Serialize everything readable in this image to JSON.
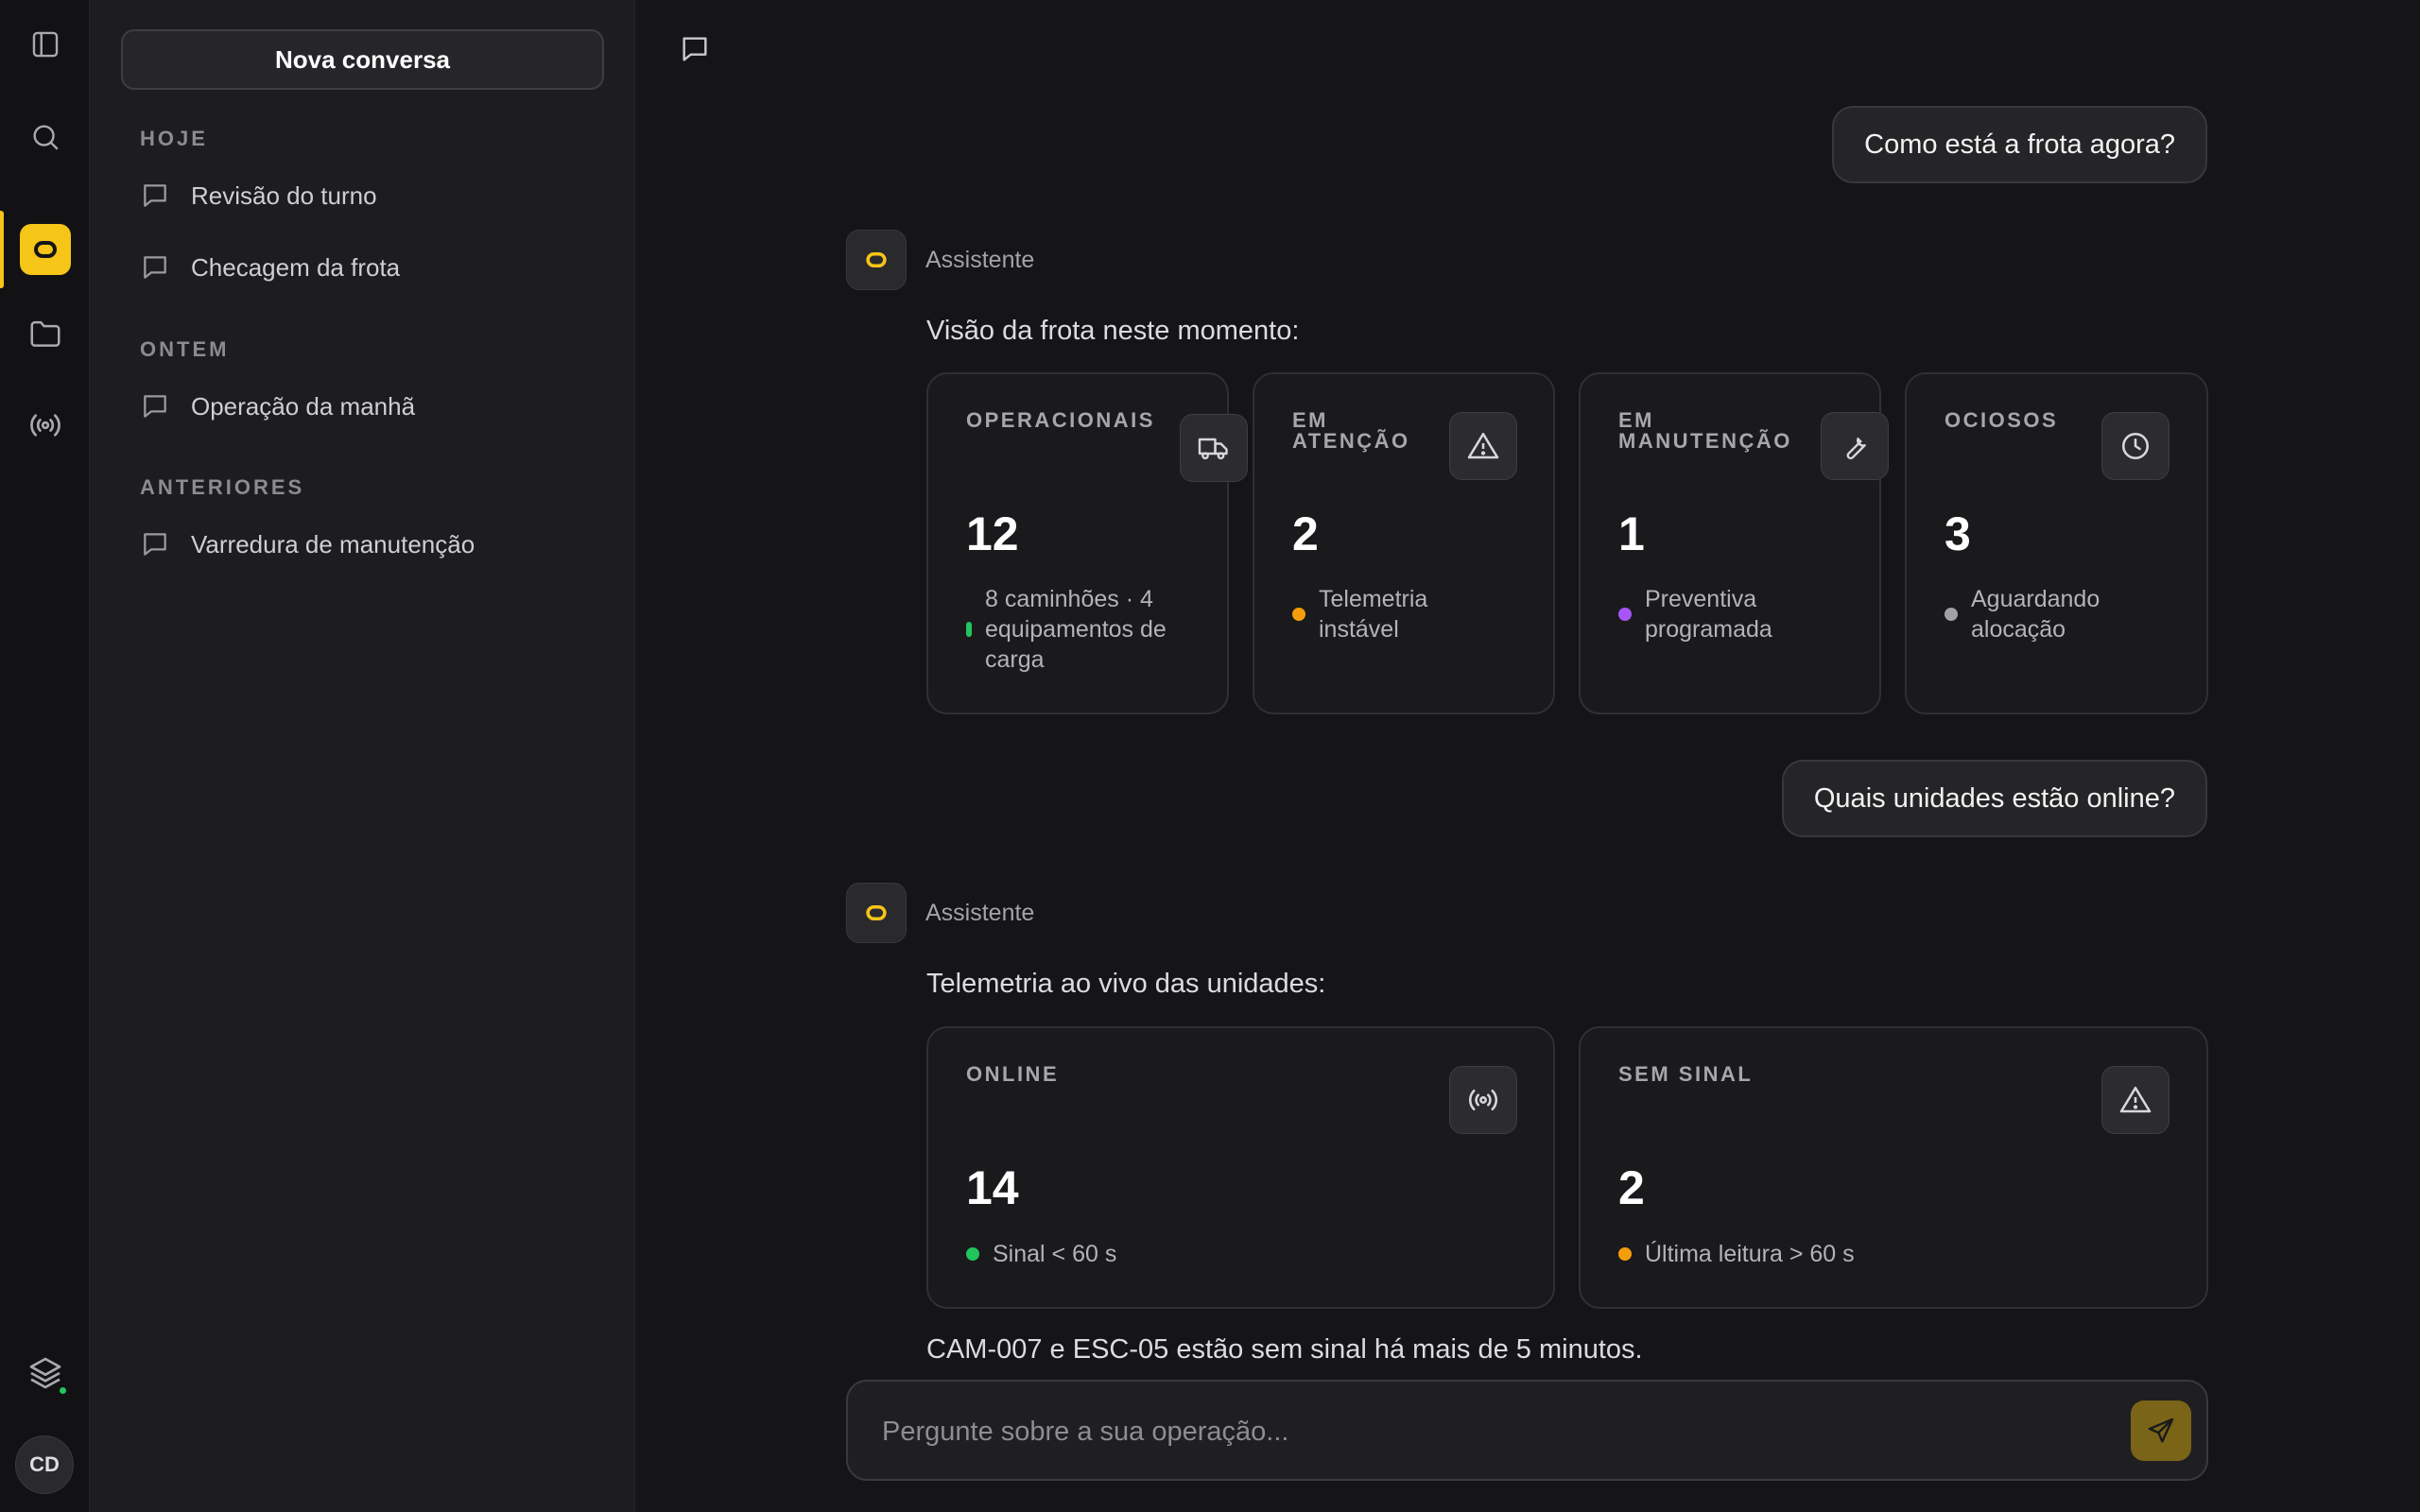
{
  "rail": {
    "avatar_initials": "CD",
    "accent_color": "#f5c518",
    "icons": [
      "sidebar-toggle-icon",
      "search-icon",
      "logo-icon",
      "folder-icon",
      "broadcast-icon",
      "layers-icon"
    ]
  },
  "sidebar": {
    "new_chat_label": "Nova conversa",
    "sections": [
      {
        "label": "HOJE",
        "items": [
          "Revisão do turno",
          "Checagem da frota"
        ]
      },
      {
        "label": "ONTEM",
        "items": [
          "Operação da manhã"
        ]
      },
      {
        "label": "ANTERIORES",
        "items": [
          "Varredura de manutenção"
        ]
      }
    ]
  },
  "chat": {
    "assistant_name": "Assistente",
    "messages": [
      {
        "role": "user",
        "text": "Como está a frota agora?"
      },
      {
        "role": "assistant",
        "intro": "Visão da frota neste momento:",
        "cards": [
          {
            "label": "OPERACIONAIS",
            "value": "12",
            "note": "8 caminhões · 4 equipamentos de carga",
            "dot_color": "#22c55e",
            "icon": "truck-icon"
          },
          {
            "label": "EM ATENÇÃO",
            "value": "2",
            "note": "Telemetria instável",
            "dot_color": "#f59e0b",
            "icon": "warning-icon"
          },
          {
            "label": "EM MANUTENÇÃO",
            "value": "1",
            "note": "Preventiva programada",
            "dot_color": "#a855f7",
            "icon": "wrench-icon"
          },
          {
            "label": "OCIOSOS",
            "value": "3",
            "note": "Aguardando alocação",
            "dot_color": "#a1a1a6",
            "icon": "clock-icon"
          }
        ]
      },
      {
        "role": "user",
        "text": "Quais unidades estão online?"
      },
      {
        "role": "assistant",
        "intro": "Telemetria ao vivo das unidades:",
        "cards": [
          {
            "label": "ONLINE",
            "value": "14",
            "note": "Sinal < 60 s",
            "dot_color": "#22c55e",
            "icon": "broadcast-icon"
          },
          {
            "label": "SEM SINAL",
            "value": "2",
            "note": "Última leitura > 60 s",
            "dot_color": "#f59e0b",
            "icon": "warning-icon"
          }
        ],
        "footer": "CAM-007 e ESC-05 estão sem sinal há mais de 5 minutos."
      }
    ]
  },
  "composer": {
    "placeholder": "Pergunte sobre a sua operação...",
    "send_color": "#7a6418"
  }
}
